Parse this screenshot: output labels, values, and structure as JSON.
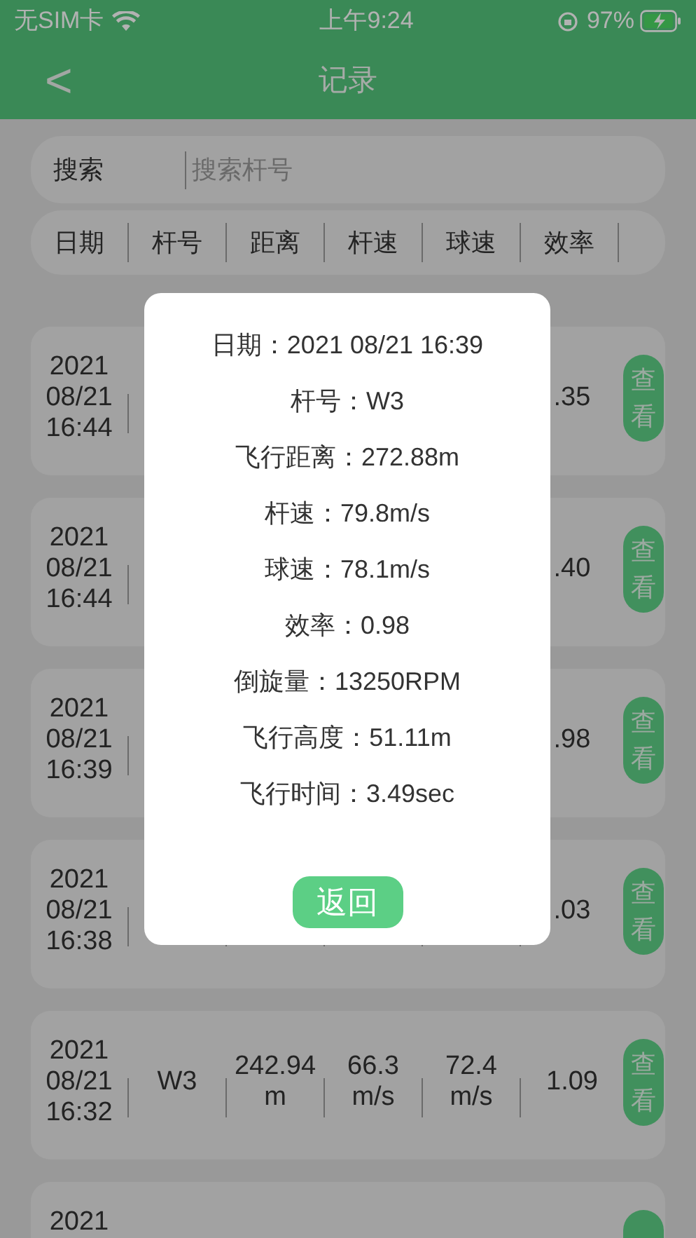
{
  "status_bar": {
    "carrier": "无SIM卡",
    "time": "上午9:24",
    "battery": "97%"
  },
  "nav": {
    "back": "<",
    "title": "记录"
  },
  "search": {
    "label": "搜索",
    "placeholder": "搜索杆号"
  },
  "columns": [
    "日期",
    "杆号",
    "距离",
    "杆速",
    "球速",
    "效率"
  ],
  "rows": [
    {
      "date": "2021\n08/21\n16:44",
      "efficiency": ".35",
      "action": "查看"
    },
    {
      "date": "2021\n08/21\n16:44",
      "efficiency": ".40",
      "action": "查看"
    },
    {
      "date": "2021\n08/21\n16:39",
      "efficiency": ".98",
      "action": "查看"
    },
    {
      "date": "2021\n08/21\n16:38",
      "efficiency": ".03",
      "action": "查看"
    },
    {
      "date": "2021\n08/21\n16:32",
      "club": "W3",
      "distance": "242.94\nm",
      "club_speed": "66.3\nm/s",
      "ball_speed": "72.4\nm/s",
      "efficiency": "1.09",
      "action": "查看"
    },
    {
      "date": "2021"
    }
  ],
  "dialog": {
    "lines": [
      "日期：2021 08/21 16:39",
      "杆号：W3",
      "飞行距离：272.88m",
      "杆速：79.8m/s",
      "球速：78.1m/s",
      "效率：0.98",
      "倒旋量：13250RPM",
      "飞行高度：51.11m",
      "飞行时间：3.49sec"
    ],
    "button": "返回"
  }
}
